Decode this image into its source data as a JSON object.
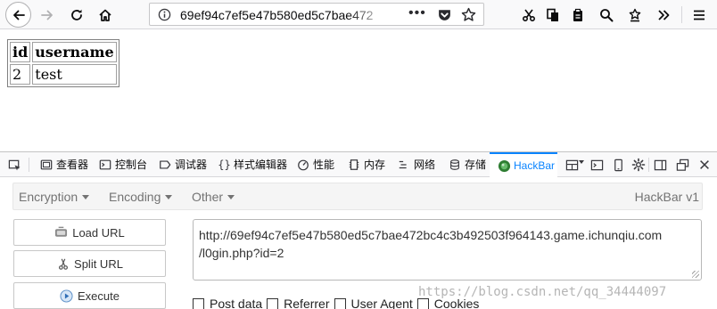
{
  "browser": {
    "url": "69ef94c7ef5e47b580ed5c7bae472",
    "url_overflow": "•••"
  },
  "page": {
    "table": {
      "headers": [
        "id",
        "username"
      ],
      "rows": [
        [
          "2",
          "test"
        ]
      ]
    }
  },
  "devtools": {
    "tabs": [
      {
        "label": "查看器",
        "icon": "inspector-icon"
      },
      {
        "label": "控制台",
        "icon": "console-icon"
      },
      {
        "label": "调试器",
        "icon": "debugger-icon"
      },
      {
        "label": "样式编辑器",
        "icon": "style-editor-icon"
      },
      {
        "label": "性能",
        "icon": "performance-icon"
      },
      {
        "label": "内存",
        "icon": "memory-icon"
      },
      {
        "label": "网络",
        "icon": "network-icon"
      },
      {
        "label": "存储",
        "icon": "storage-icon"
      },
      {
        "label": "HackBar",
        "icon": "hackbar-icon",
        "active": true
      }
    ],
    "accent_color": "#0a84ff"
  },
  "hackbar": {
    "menus": [
      "Encryption",
      "Encoding",
      "Other"
    ],
    "version": "HackBar v1",
    "buttons": {
      "load_url": "Load URL",
      "split_url": "Split URL",
      "execute": "Execute"
    },
    "url_lines": [
      "http://69ef94c7ef5e47b580ed5c7bae472bc4c3b492503f964143.game.ichunqiu.com",
      "/l0gin.php?id=2"
    ],
    "options": [
      "Post data",
      "Referrer",
      "User Agent",
      "Cookies"
    ]
  },
  "watermark": "https://blog.csdn.net/qq_34444097"
}
